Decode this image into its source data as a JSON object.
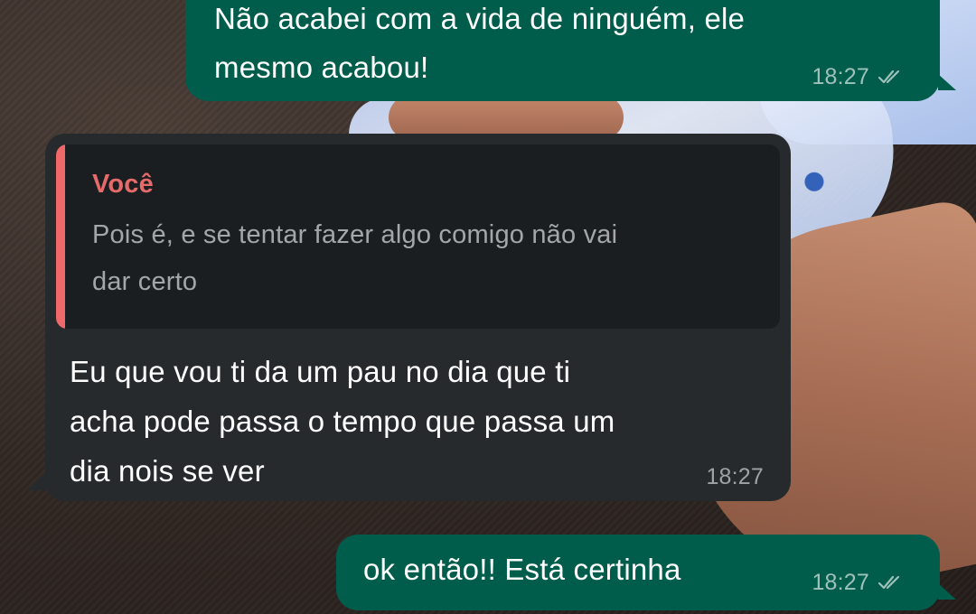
{
  "messages": [
    {
      "direction": "outgoing",
      "text_line1": "Não acabei com a vida de ninguém, ele",
      "text_line2": "mesmo acabou!",
      "time": "18:27",
      "status_icon": "double-check-icon"
    },
    {
      "direction": "incoming",
      "quoted": {
        "author": "Você",
        "text_line1": "Pois é, e se tentar fazer algo comigo não vai",
        "text_line2": "dar certo"
      },
      "text_line1": "Eu que vou ti da um pau no dia que ti",
      "text_line2": "acha pode passa o tempo que passa um",
      "text_line3": "dia nois se ver",
      "time": "18:27"
    },
    {
      "direction": "outgoing",
      "text_line1": "ok então!! Está certinha",
      "time": "18:27",
      "status_icon": "double-check-icon"
    }
  ],
  "colors": {
    "outgoing_bubble": "#005c4b",
    "incoming_bubble": "#262a2d",
    "quote_accent": "#f0696a",
    "quote_author": "#e56b6b"
  }
}
